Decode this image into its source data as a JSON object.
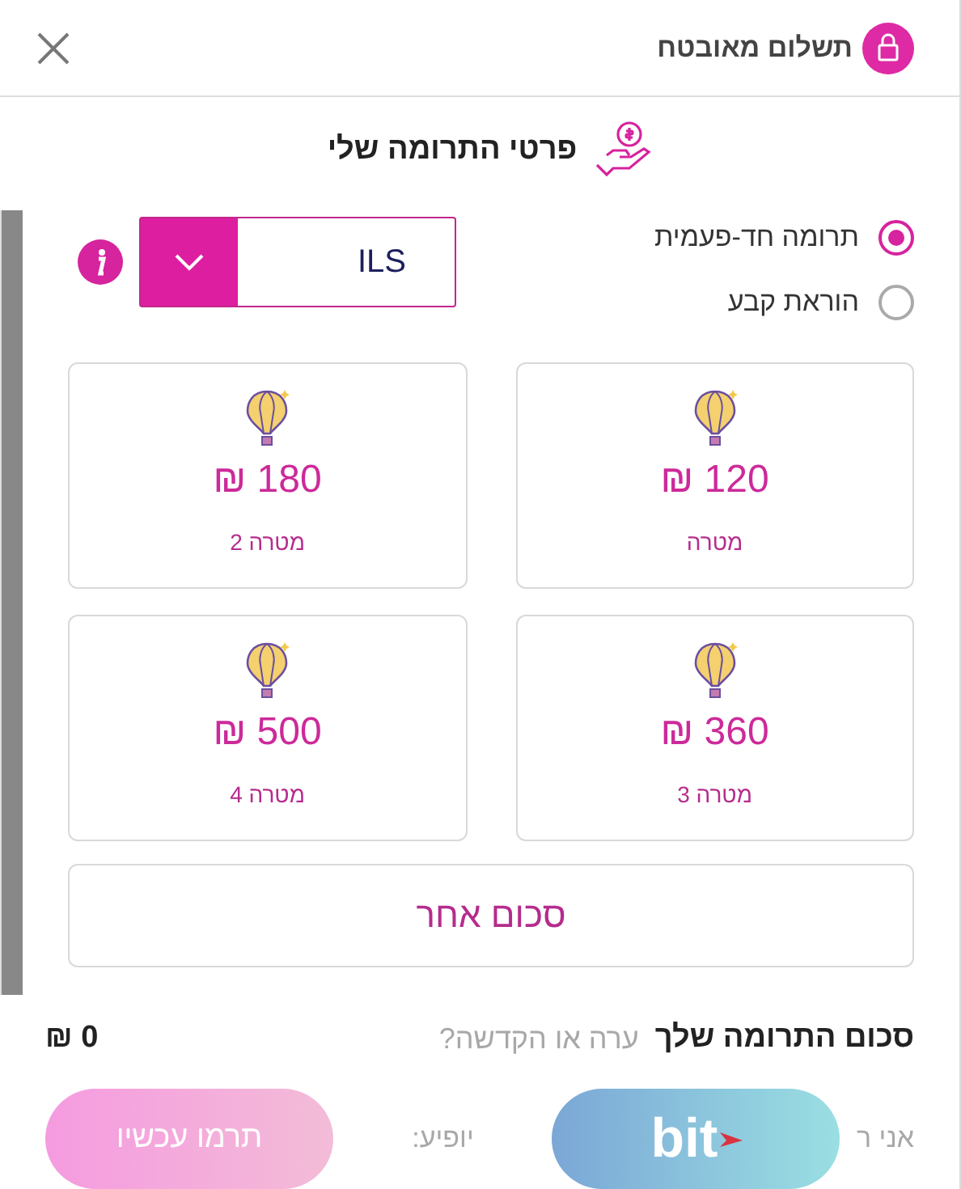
{
  "header": {
    "title": "תשלום מאובטח"
  },
  "section_title": "פרטי התרומה שלי",
  "frequency": [
    {
      "label": "תרומה חד-פעמית",
      "selected": true
    },
    {
      "label": "הוראת קבע",
      "selected": false
    }
  ],
  "currency": {
    "value": "ILS"
  },
  "amounts": [
    {
      "amount": "120 ₪",
      "caption": "מטרה"
    },
    {
      "amount": "180 ₪",
      "caption": "מטרה 2"
    },
    {
      "amount": "360 ₪",
      "caption": "מטרה 3"
    },
    {
      "amount": "500 ₪",
      "caption": "מטרה 4"
    }
  ],
  "other_amount": "סכום אחר",
  "faded_behind_footer": [
    "ערה או הקדשה?",
    "אני ר",
    "יופיע:"
  ],
  "footer": {
    "total_label": "סכום התרומה שלך",
    "total": "0 ₪",
    "bit_label": "bit",
    "donate_button": "תרמו עכשיו"
  }
}
